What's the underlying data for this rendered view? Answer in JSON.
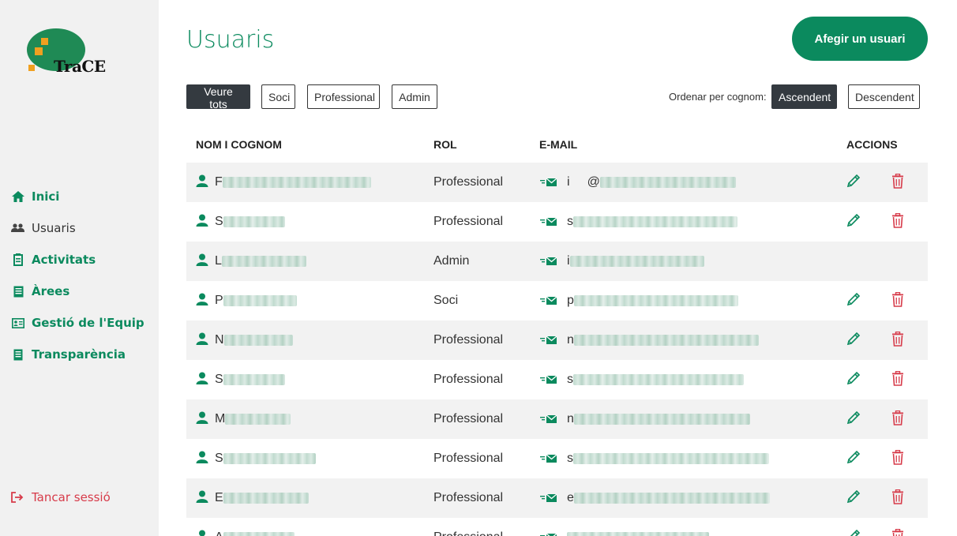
{
  "logo": {
    "text": "TraCE"
  },
  "sidebar": {
    "items": [
      {
        "label": "Inici",
        "icon": "home-icon",
        "active": false
      },
      {
        "label": "Usuaris",
        "icon": "users-icon",
        "active": true
      },
      {
        "label": "Activitats",
        "icon": "activity-icon",
        "active": false
      },
      {
        "label": "Àrees",
        "icon": "list-icon",
        "active": false
      },
      {
        "label": "Gestió de l'Equip",
        "icon": "id-card-icon",
        "active": false
      },
      {
        "label": "Transparència",
        "icon": "document-icon",
        "active": false
      }
    ],
    "logout": "Tancar sessió"
  },
  "header": {
    "title": "Usuaris",
    "add_button": "Afegir un usuari"
  },
  "filters": {
    "buttons": [
      "Veure tots",
      "Soci",
      "Professional",
      "Admin"
    ],
    "active": "Veure tots",
    "sort_label": "Ordenar per cognom:",
    "sort_buttons": [
      "Ascendent",
      "Descendent"
    ],
    "sort_active": "Ascendent"
  },
  "table": {
    "headers": [
      "NOM I COGNOM",
      "ROL",
      "E-MAIL",
      "ACCIONS"
    ],
    "rows": [
      {
        "name_initial": "F",
        "role": "Professional",
        "email_initial": "i",
        "email_visible": "@",
        "has_actions": true
      },
      {
        "name_initial": "S",
        "role": "Professional",
        "email_initial": "s",
        "has_actions": true
      },
      {
        "name_initial": "L",
        "role": "Admin",
        "email_initial": "i",
        "has_actions": false
      },
      {
        "name_initial": "P",
        "role": "Soci",
        "email_initial": "p",
        "has_actions": true
      },
      {
        "name_initial": "N",
        "role": "Professional",
        "email_initial": "n",
        "has_actions": true
      },
      {
        "name_initial": "S",
        "role": "Professional",
        "email_initial": "s",
        "has_actions": true
      },
      {
        "name_initial": "M",
        "role": "Professional",
        "email_initial": "n",
        "has_actions": true
      },
      {
        "name_initial": "S",
        "role": "Professional",
        "email_initial": "s",
        "has_actions": true
      },
      {
        "name_initial": "E",
        "role": "Professional",
        "email_initial": "e",
        "has_actions": true
      },
      {
        "name_initial": "A",
        "role": "Professional",
        "email_initial": "",
        "has_actions": true
      }
    ]
  },
  "colors": {
    "primary": "#0b8a5e",
    "danger": "#d73b4a",
    "dark": "#343a40",
    "sidebar_bg": "#f1f1f1",
    "row_alt": "#f2f2f2"
  }
}
